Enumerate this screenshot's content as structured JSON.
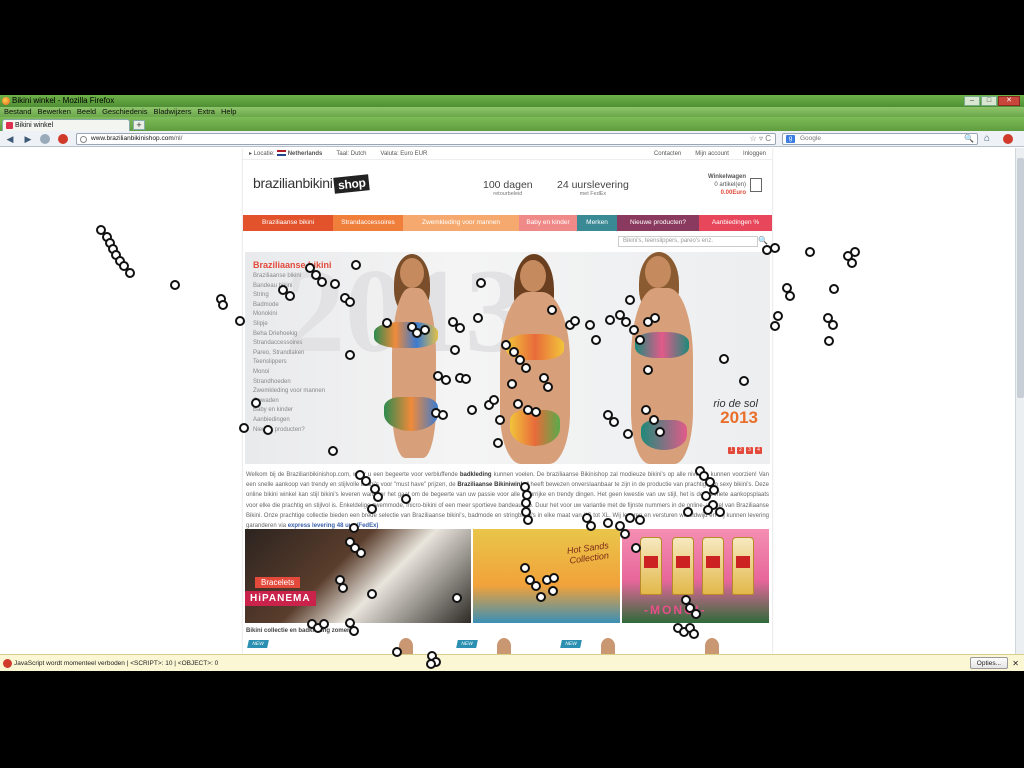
{
  "window": {
    "title": "Bikini winkel - Mozilla Firefox",
    "buttons": [
      "–",
      "□",
      "✕"
    ]
  },
  "menubar": [
    "Bestand",
    "Bewerken",
    "Beeld",
    "Geschiedenis",
    "Bladwijzers",
    "Extra",
    "Help"
  ],
  "tab": {
    "label": "Bikini winkel",
    "newtab": "+"
  },
  "navbar": {
    "url_domain": "www.brazilianbikinishop.com",
    "url_path": "/nl/",
    "url_tail": "☆ ▿ C",
    "search_placeholder": "Google",
    "search_engine": "g",
    "back_icon": "◀",
    "forward_icon": "▶",
    "home_icon": "⌂",
    "magnifier": "🔍"
  },
  "topstrip": {
    "locatie": "Locatie:",
    "country": "Netherlands",
    "taal": "Taal: Dutch",
    "valuta": "Valuta: Euro EUR",
    "contact": "Contacten",
    "account": "Mijn account",
    "login": "Inloggen"
  },
  "logo": {
    "text": "brazilianbikini",
    "shop": "shop"
  },
  "usp": [
    {
      "big": "100 dagen",
      "small": "retourbeleid"
    },
    {
      "big": "24 uurslevering",
      "small": "met FedEx"
    }
  ],
  "cart": {
    "title": "Winkelwagen",
    "items": "0 artikel(en)",
    "price": "0.00Euro"
  },
  "catnav": [
    {
      "label": "Braziliaanse bikini",
      "color": "#e2532b"
    },
    {
      "label": "Strandaccessoires",
      "color": "#f07f3c"
    },
    {
      "label": "Zwemkleding voor mannen",
      "color": "#f5a96e"
    },
    {
      "label": "Baby en kinder",
      "color": "#f08a88"
    },
    {
      "label": "Merken",
      "color": "#3a8a96"
    },
    {
      "label": "Nieuwe producten?",
      "color": "#8a3a5e"
    },
    {
      "label": "Aanbiedingen %",
      "color": "#e8465a"
    }
  ],
  "sitesearch": {
    "placeholder": "Bikini's, teenslippers, pareo's enz.",
    "button": "🔍"
  },
  "sidemenu": {
    "title": "Braziliaanse bikini",
    "items": [
      "Braziliaanse bikini",
      "Bandeau bikini",
      "String",
      "Badmode",
      "Monokini",
      "Slipje",
      "Beha Driehoekig",
      "Strandaccessoires",
      "Pareo, Strandlaken",
      "Teenslippers",
      "Monoi",
      "Strandhoeden",
      "Zwemkleding voor mannen",
      "Gewaden",
      "Baby en kinder",
      "Aanbiedingen",
      "Nieuwe producten?"
    ]
  },
  "hero": {
    "watermark": "2013",
    "brand": "rio de sol",
    "year": "2013",
    "pager": [
      "1",
      "2",
      "3",
      "4"
    ]
  },
  "intro": {
    "p1": "Welkom bij de Brazilianbikinishop.com, waar u een begeerte voor verbluffende ",
    "b1": "badkleding",
    "p2": " kunnen voelen. De braziliaanse Bikinishop zal modieuze bikini's op alle niveaus kunnen voorzien! Van een snelle aankoop van trendy en stijlvolle bikini's voor \"must have\" prijzen, de ",
    "b2": "Braziliaanse Bikiniwinkel",
    "p3": " heeft bewezen onverslaanbaar te zijn in de productie van prachtige en sexy bikini's. Deze online bikini winkel kan stijl bikini's leveren wanneer het gaat om de begeerte van uw passie voor alle kleurrijke en trendy dingen. Het geen kwestie van uw stijl, het is de favoriete aankopsplaats voor elke die prachtig en stijlvol is. Enkeldelige zwemmode, micro-bikini of een meer sportieve bandeau top. Duur het voor uw variantie met de fijnste nummers in de online- winkel van Braziliaanse Bikini. Onze prachtige collectie bieden een brede selectie van Braziliaanse bikini's, badmode en stringbikini's in elke maat van XS tot XL. Wij leveren en versturen wereldwijd en wij kunnen levering garanderen via ",
    "hl": "express levering 48 uur (FedEx)"
  },
  "promos": {
    "bracelets": "Bracelets",
    "hipanema": "HiPANEMA",
    "hotsands": "Hot Sands Collection",
    "monoi": "-MONOI-"
  },
  "collection": {
    "title": "Bikini collectie en badkleding zomer",
    "new": "NEW"
  },
  "notification": {
    "text": "JavaScript wordt momenteel verboden | <SCRIPT>: 10 | <OBJECT>: 0",
    "options": "Opties...",
    "close": "✕"
  }
}
